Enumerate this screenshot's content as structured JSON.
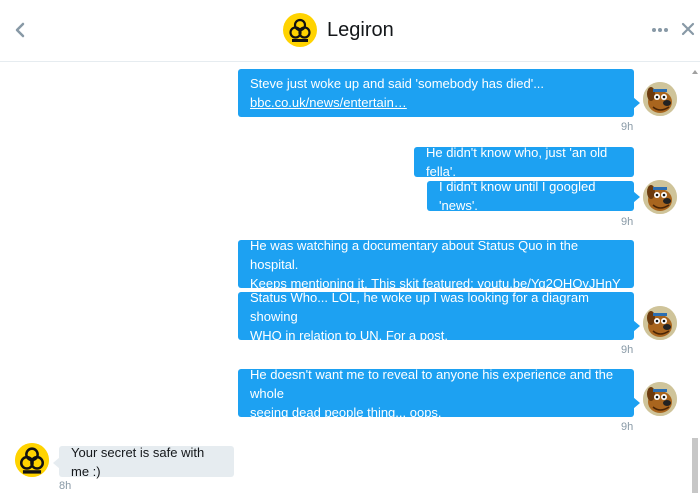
{
  "header": {
    "title": "Legiron",
    "back_icon": "chevron-left-icon",
    "more_icon": "more-dots-icon",
    "close_icon": "close-icon"
  },
  "avatars": {
    "contact_logo_text": "Biohazard"
  },
  "messages": [
    {
      "line1": "Steve just woke up and said 'somebody has died'...",
      "link": "bbc.co.uk/news/entertain…",
      "time": "9h"
    },
    {
      "text": "He didn't know who, just 'an old fella'."
    },
    {
      "text": "I didn't know until I googled 'news'.",
      "time": "9h"
    },
    {
      "line1": "He was watching a documentary about Status Quo in the hospital.",
      "line2_prefix": "Keeps mentioning it. This skit featured: ",
      "link": "youtu.be/Yq2OHOyJHnY"
    },
    {
      "line1": "Status Who... LOL, he woke up I was looking for a diagram showing",
      "line2": "WHO in relation to UN. For a post.",
      "time": "9h"
    },
    {
      "line1": "He doesn't want me to reveal to anyone his experience and the whole",
      "line2": "seeing dead people thing... oops.",
      "time": "9h"
    }
  ],
  "reply": {
    "text": "Your secret is safe with me :)",
    "time": "8h"
  },
  "colors": {
    "sent_bubble": "#1da1f2",
    "received_bubble": "#e6ecf0",
    "timestamp": "#8899a6"
  }
}
